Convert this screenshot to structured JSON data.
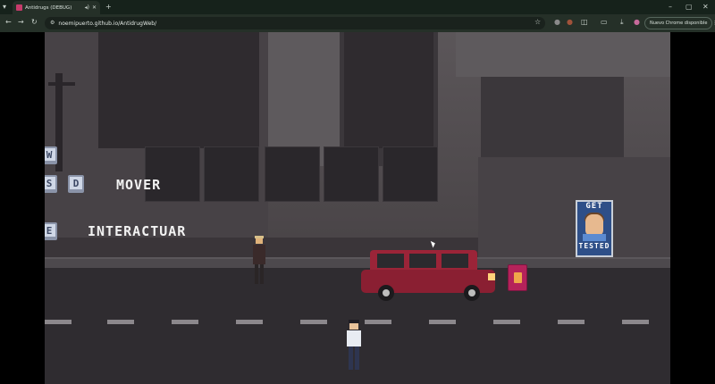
{
  "browser": {
    "tab": {
      "title": "Antidrugs (DEBUG)"
    },
    "new_tab": "+",
    "window_controls": {
      "minimize": "–",
      "restore": "▢",
      "close": "✕"
    },
    "nav": {
      "back": "←",
      "forward": "→",
      "reload": "↻"
    },
    "url": "noemipuerto.github.io/AntidrugWeb/",
    "update_chip": "Nuevo Chrome disponible"
  },
  "game": {
    "controls": {
      "move_keys": [
        "W",
        "S",
        "D"
      ],
      "move_label": "MOVER",
      "interact_key": "E",
      "interact_label": "INTERACTUAR"
    },
    "poster": {
      "top_text": "GET",
      "bottom_text": "TESTED"
    },
    "colors": {
      "car": "#9b2438",
      "poster_bg": "#2e4f88",
      "can": "#b5225a"
    }
  }
}
